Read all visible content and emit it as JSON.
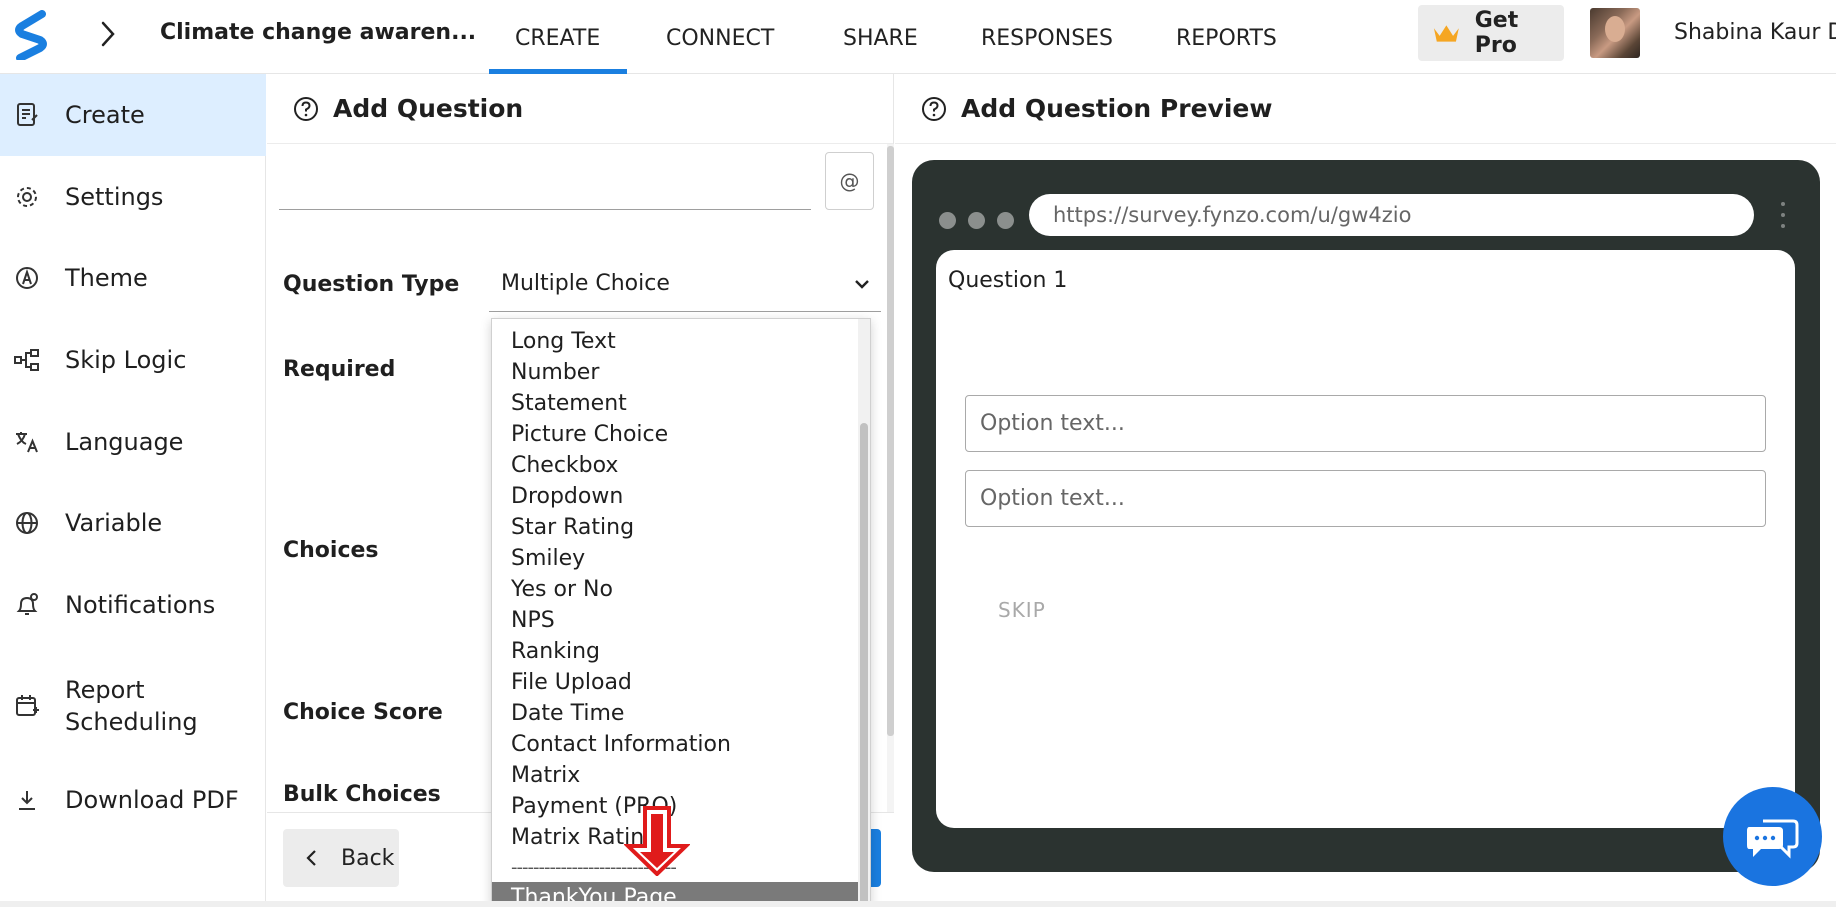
{
  "header": {
    "survey_title": "Climate change awaren...",
    "tabs": [
      {
        "label": "CREATE",
        "active": true
      },
      {
        "label": "CONNECT"
      },
      {
        "label": "SHARE"
      },
      {
        "label": "RESPONSES"
      },
      {
        "label": "REPORTS"
      }
    ],
    "get_pro_label": "Get Pro",
    "user_name": "Shabina Kaur Dh",
    "accent_color": "#1a7fe0"
  },
  "sidebar": {
    "items": [
      {
        "label": "Create",
        "icon": "form-icon",
        "active": true
      },
      {
        "label": "Settings",
        "icon": "gear-icon"
      },
      {
        "label": "Theme",
        "icon": "theme-icon"
      },
      {
        "label": "Skip Logic",
        "icon": "flow-icon"
      },
      {
        "label": "Language",
        "icon": "translate-icon"
      },
      {
        "label": "Variable",
        "icon": "globe-icon"
      },
      {
        "label": "Notifications",
        "icon": "bell-icon"
      },
      {
        "label": "Report Scheduling",
        "icon": "calendar-icon"
      },
      {
        "label": "Download PDF",
        "icon": "download-icon"
      }
    ]
  },
  "editor": {
    "title": "Add Question",
    "at_button": "@",
    "question_type_label": "Question Type",
    "question_type_value": "Multiple Choice",
    "required_label": "Required",
    "choices_label": "Choices",
    "choice_score_label": "Choice Score",
    "bulk_choices_label": "Bulk Choices",
    "back_label": "Back"
  },
  "dropdown": {
    "options": [
      "Long Text",
      "Number",
      "Statement",
      "Picture Choice",
      "Checkbox",
      "Dropdown",
      "Star Rating",
      "Smiley",
      "Yes or No",
      "NPS",
      "Ranking",
      "File Upload",
      "Date Time",
      "Contact Information",
      "Matrix",
      "Payment (PRO)",
      "Matrix Rating"
    ],
    "separator": "------------------------------",
    "highlighted": "ThankYou Page"
  },
  "preview": {
    "title": "Add Question Preview",
    "url": "https://survey.fynzo.com/u/gw4zio",
    "question_label": "Question 1",
    "option_placeholders": [
      "Option text...",
      "Option text..."
    ],
    "skip_label": "SKIP"
  }
}
